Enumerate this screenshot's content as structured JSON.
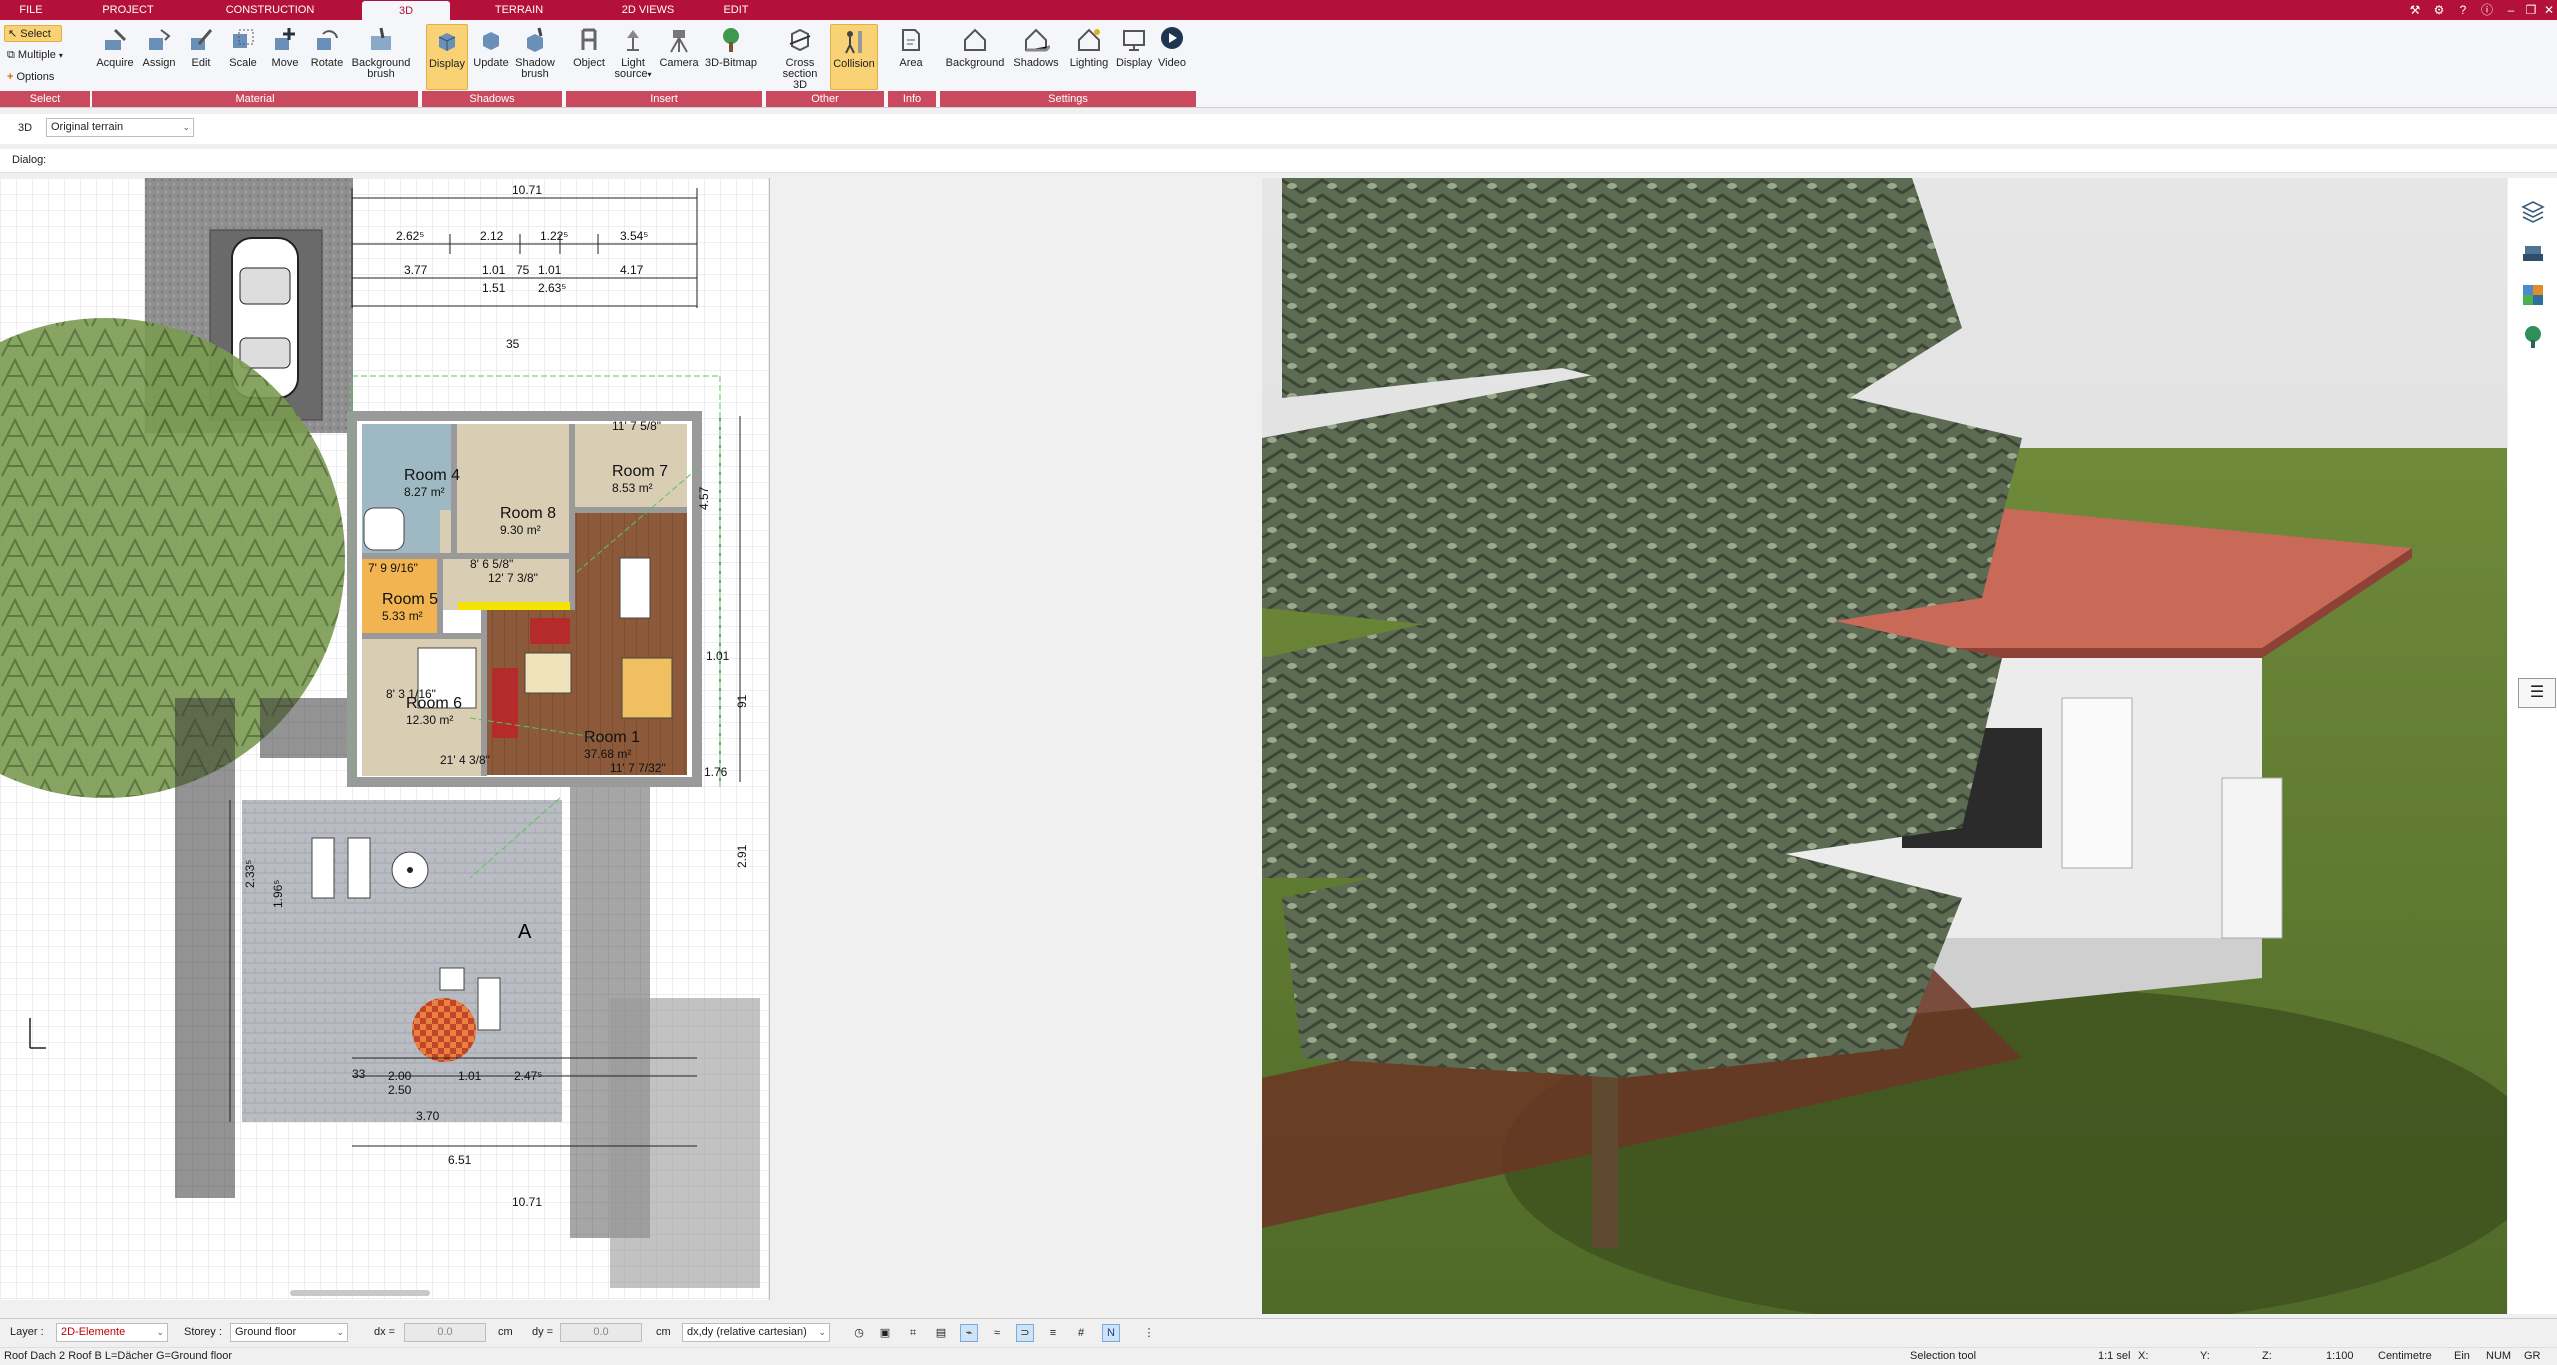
{
  "menu": {
    "tabs": [
      {
        "label": "FILE",
        "active": false
      },
      {
        "label": "PROJECT",
        "active": false
      },
      {
        "label": "CONSTRUCTION",
        "active": false
      },
      {
        "label": "3D",
        "active": true
      },
      {
        "label": "TERRAIN",
        "active": false
      },
      {
        "label": "2D VIEWS",
        "active": false
      },
      {
        "label": "EDIT",
        "active": false
      }
    ],
    "window_icons": [
      "tools-icon",
      "settings-icon",
      "help-icon",
      "info-icon",
      "minimize-icon",
      "restore-icon",
      "close-icon"
    ]
  },
  "ribbon": {
    "select": {
      "select_label": "Select",
      "multiple_label": "Multiple",
      "options_label": "Options",
      "group": "Select"
    },
    "material": {
      "acquire": "Acquire",
      "assign": "Assign",
      "edit": "Edit",
      "scale": "Scale",
      "move": "Move",
      "rotate": "Rotate",
      "background_brush_1": "Background",
      "background_brush_2": "brush",
      "group": "Material"
    },
    "shadows": {
      "display": "Display",
      "update": "Update",
      "shadow_brush_1": "Shadow",
      "shadow_brush_2": "brush",
      "group": "Shadows"
    },
    "insert": {
      "object": "Object",
      "light_1": "Light",
      "light_2": "source",
      "camera": "Camera",
      "bitmap": "3D-Bitmap",
      "group": "Insert"
    },
    "other": {
      "cross_1": "Cross",
      "cross_2": "section 3D",
      "collision": "Collision",
      "group": "Other"
    },
    "info": {
      "area": "Area",
      "group": "Info"
    },
    "settings": {
      "background": "Background",
      "shadows": "Shadows",
      "lighting": "Lighting",
      "display": "Display",
      "video": "Video",
      "group": "Settings"
    }
  },
  "viewbar": {
    "mode": "3D",
    "terrain": "Original terrain"
  },
  "dialog": {
    "label": "Dialog:"
  },
  "plan": {
    "rooms": [
      {
        "name": "Room 4",
        "area": "8.27 m²"
      },
      {
        "name": "Room 7",
        "area": "8.53 m²"
      },
      {
        "name": "Room 8",
        "area": "9.30 m²"
      },
      {
        "name": "Room 5",
        "area": "5.33 m²"
      },
      {
        "name": "Room 6",
        "area": "12.30 m²"
      },
      {
        "name": "Room 1",
        "area": "37.68 m²"
      }
    ],
    "dims": {
      "top_total": "10.71",
      "top_a": "2.62⁵",
      "top_b": "2.12",
      "top_c": "1.22⁵",
      "top_d": "3.54⁵",
      "row2_a": "3.77",
      "row2_b": "1.01",
      "row2_c": "1.01",
      "row2_d": "4.17",
      "row2_e": "75",
      "row2_f": "1.51",
      "row2_g": "2.63⁵",
      "bottom_total": "10.71",
      "bottom_a": "2.00",
      "bottom_b": "2.50",
      "bottom_c": "1.01",
      "bottom_d": "2.47⁵",
      "left_a": "2.33⁵",
      "left_b": "1.96⁵",
      "side_r1": "4.57",
      "side_r2": "1.01",
      "side_r3": "91",
      "side_r4": "1.76",
      "side_r5": "2.91",
      "small_a": "35",
      "small_b": "33",
      "small_c": "6.51",
      "small_d": "3.70",
      "room_dim_1": "21' 4 3/8\"",
      "room_dim_2": "12' 7 3/8\"",
      "room_dim_3": "11' 7 5/8\"",
      "room_dim_4": "11' 7 7/32\"",
      "room_dim_5": "8' 3 1/16\"",
      "room_dim_6": "8' 6 5/8\"",
      "room_dim_7": "7' 9 9/16\""
    }
  },
  "statusbar": {
    "layer_label": "Layer :",
    "layer_value": "2D-Elemente",
    "storey_label": "Storey :",
    "storey_value": "Ground floor",
    "dx_label": "dx =",
    "dx_value": "0.0",
    "dx_unit": "cm",
    "dy_label": "dy =",
    "dy_value": "0.0",
    "dy_unit": "cm",
    "coord_mode": "dx,dy (relative cartesian)"
  },
  "infobar": {
    "left": "Roof Dach 2 Roof B L=Dächer G=Ground floor",
    "tool": "Selection tool",
    "sel": "1:1 sel",
    "x": "X:",
    "y": "Y:",
    "z": "Z:",
    "scale": "1:100",
    "unit": "Centimetre",
    "ein": "Ein",
    "num": "NUM",
    "gr": "GR"
  },
  "colors": {
    "brand": "#b3113a",
    "ribbon_group": "#c94a5e",
    "pressed": "#f9d275",
    "wall": "#9a9a9a",
    "floor_wood": "#8b5a3c",
    "floor_tile": "#d9cdb4",
    "bath": "#9fb9c4",
    "grass": "#5d7530",
    "roof": "#b5574a"
  }
}
